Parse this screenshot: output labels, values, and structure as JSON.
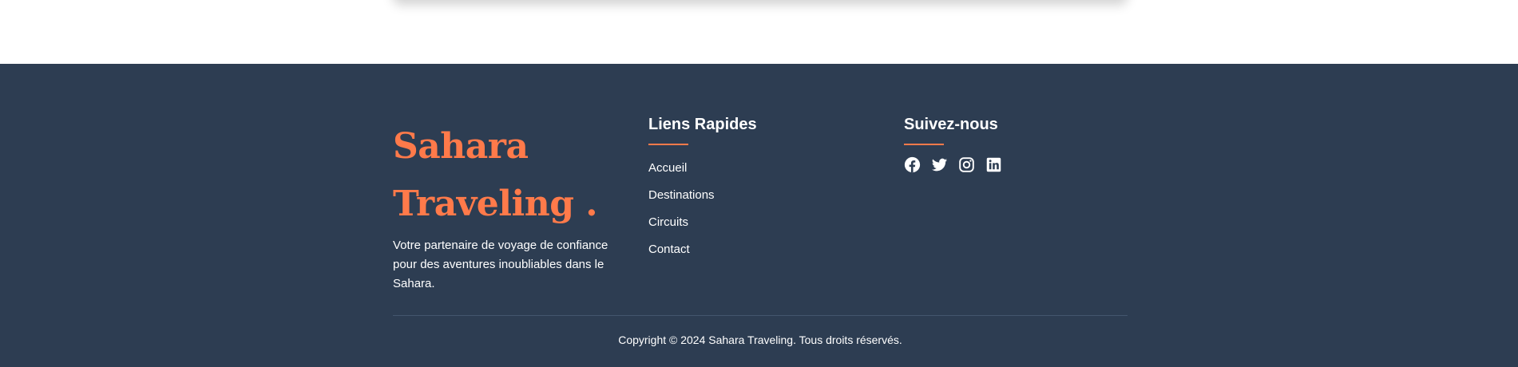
{
  "brand": {
    "name_line1": "Sahara",
    "name_line2": "Traveling .",
    "tagline": "Votre partenaire de voyage de confiance pour des aventures inoubliables dans le Sahara."
  },
  "quick_links": {
    "title": "Liens Rapides",
    "items": [
      "Accueil",
      "Destinations",
      "Circuits",
      "Contact"
    ]
  },
  "social": {
    "title": "Suivez-nous",
    "icons": [
      "facebook-icon",
      "twitter-icon",
      "instagram-icon",
      "linkedin-icon"
    ]
  },
  "copyright": "Copyright © 2024 Sahara Traveling. Tous droits réservés.",
  "colors": {
    "footer_bg": "#2d3d52",
    "accent": "#ff7a4a",
    "text": "#ffffff"
  }
}
